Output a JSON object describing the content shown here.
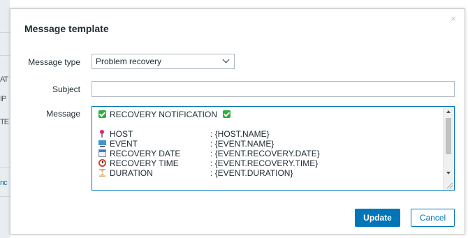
{
  "background_page": {
    "fragments": [
      "AT",
      "IP",
      "TE"
    ],
    "link_fragment": "nc"
  },
  "dialog": {
    "title": "Message template",
    "close_glyph": "×"
  },
  "form": {
    "message_type": {
      "label": "Message type",
      "value": "Problem recovery"
    },
    "subject": {
      "label": "Subject",
      "value": ""
    },
    "message": {
      "label": "Message",
      "header_text": "RECOVERY NOTIFICATION",
      "lines": [
        {
          "icon": "pin-icon",
          "key": "HOST",
          "value": ": {HOST.NAME}"
        },
        {
          "icon": "computer-icon",
          "key": "EVENT",
          "value": ": {EVENT.NAME}"
        },
        {
          "icon": "calendar-icon",
          "key": "RECOVERY DATE",
          "value": ": {EVENT.RECOVERY.DATE}"
        },
        {
          "icon": "alarm-clock-icon",
          "key": "RECOVERY TIME",
          "value": ": {EVENT.RECOVERY.TIME}"
        },
        {
          "icon": "hourglass-icon",
          "key": "DURATION",
          "value": ": {EVENT.DURATION}"
        }
      ]
    }
  },
  "buttons": {
    "update": "Update",
    "cancel": "Cancel"
  },
  "colors": {
    "accent": "#0275b8",
    "check_green": "#2eae3c"
  }
}
